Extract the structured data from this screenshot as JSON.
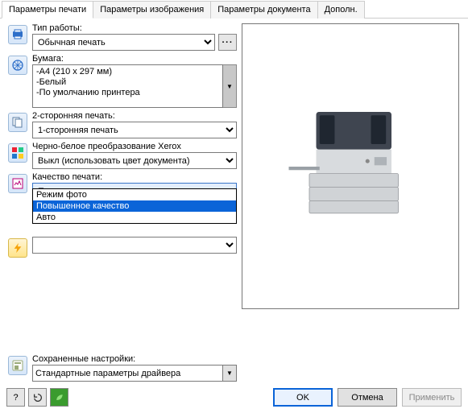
{
  "tabs": {
    "t0": "Параметры печати",
    "t1": "Параметры изображения",
    "t2": "Параметры документа",
    "t3": "Дополн."
  },
  "jobtype": {
    "label": "Тип работы:",
    "value": "Обычная печать"
  },
  "paper": {
    "label": "Бумага:",
    "line1": "A4 (210 x 297 мм)",
    "line2": "Белый",
    "line3": "По умолчанию принтера"
  },
  "duplex": {
    "label": "2-сторонняя печать:",
    "value": "1-сторонняя печать"
  },
  "bw": {
    "label": "Черно-белое преобразование Xerox",
    "value": "Выкл (использовать цвет документа)"
  },
  "quality": {
    "label": "Качество печати:",
    "value": "Повышенное качество",
    "opt0": "Режим фото",
    "opt1": "Повышенное качество",
    "opt2": "Авто"
  },
  "saved": {
    "label": "Сохраненные настройки:",
    "value": "Стандартные параметры драйвера"
  },
  "buttons": {
    "ok": "OK",
    "cancel": "Отмена",
    "apply": "Применить",
    "help": "?"
  }
}
